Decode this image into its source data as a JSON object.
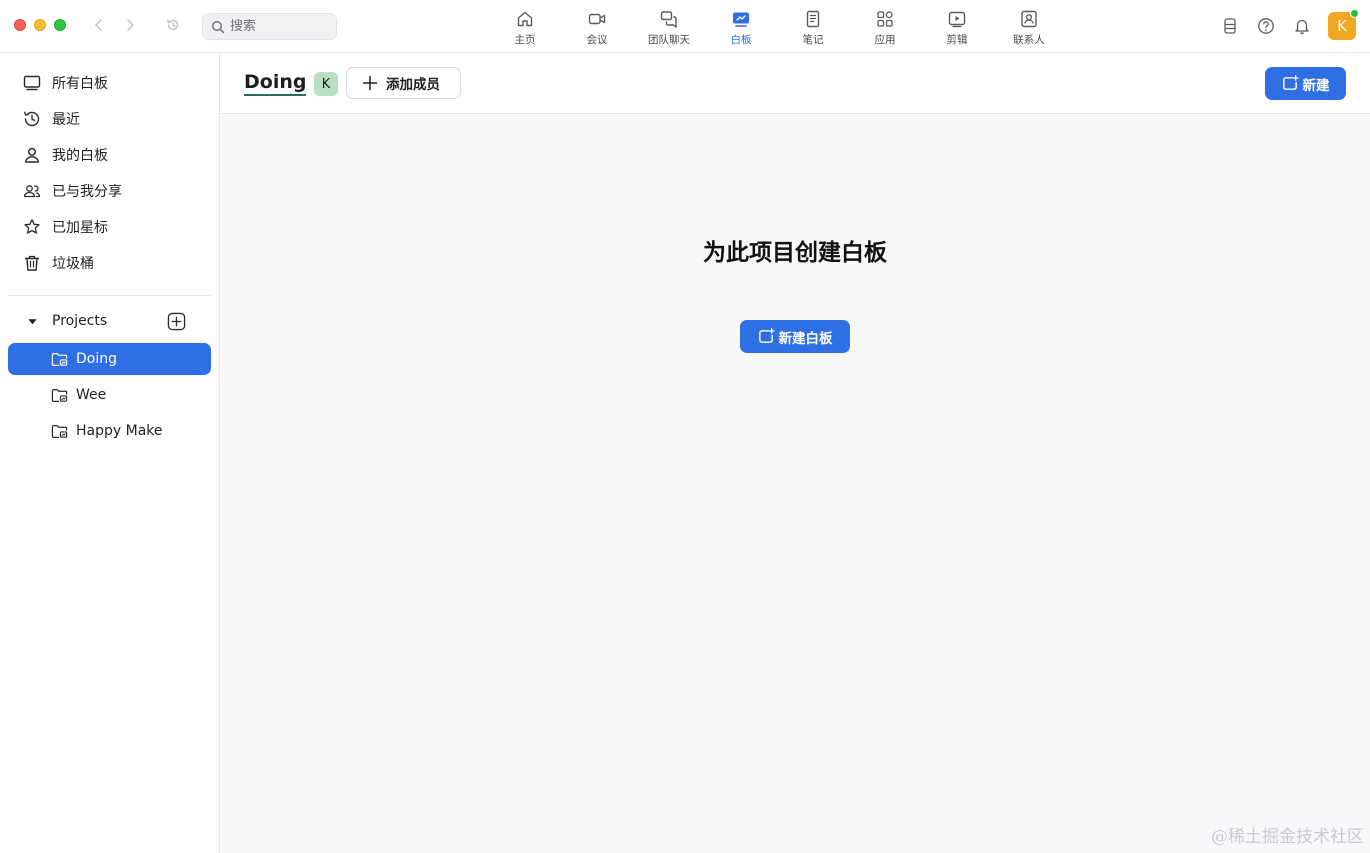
{
  "window": {
    "search": {
      "placeholder": "搜索"
    }
  },
  "top_tabs": [
    {
      "label": "主页",
      "icon": "home-icon"
    },
    {
      "label": "会议",
      "icon": "video-camera-icon"
    },
    {
      "label": "团队聊天",
      "icon": "chat-bubbles-icon"
    },
    {
      "label": "白板",
      "icon": "whiteboard-icon",
      "active": true
    },
    {
      "label": "笔记",
      "icon": "notes-icon"
    },
    {
      "label": "应用",
      "icon": "apps-icon"
    },
    {
      "label": "剪辑",
      "icon": "clips-icon"
    },
    {
      "label": "联系人",
      "icon": "contacts-icon"
    }
  ],
  "user": {
    "avatar_initial": "K",
    "avatar_color": "#f2a724",
    "status_color": "#1fbf4a"
  },
  "sidebar": {
    "items": [
      {
        "label": "所有白板",
        "icon": "board-icon"
      },
      {
        "label": "最近",
        "icon": "clock-icon"
      },
      {
        "label": "我的白板",
        "icon": "person-icon"
      },
      {
        "label": "已与我分享",
        "icon": "people-icon"
      },
      {
        "label": "已加星标",
        "icon": "star-icon"
      },
      {
        "label": "垃圾桶",
        "icon": "trash-icon"
      }
    ],
    "projects": {
      "label": "Projects",
      "items": [
        {
          "label": "Doing",
          "active": true
        },
        {
          "label": "Wee"
        },
        {
          "label": "Happy Make"
        }
      ]
    }
  },
  "main": {
    "project_title": "Doing",
    "member_initial": "K",
    "add_member_label": "添加成员",
    "new_label": "新建",
    "empty_title": "为此项目创建白板",
    "new_board_label": "新建白板"
  },
  "watermark": "@稀土掘金技术社区",
  "colors": {
    "accent": "#2f6fe4",
    "member_avatar": "#b9dfc1"
  }
}
